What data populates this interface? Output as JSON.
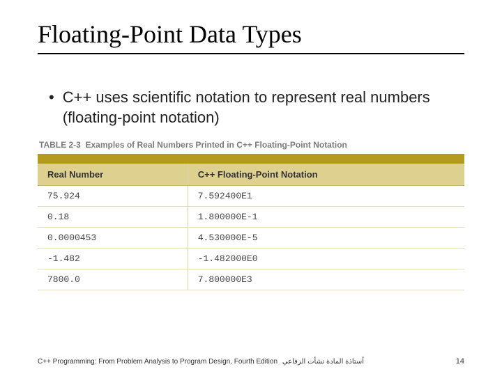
{
  "title": "Floating-Point Data Types",
  "bullets": [
    "C++ uses scientific notation to represent real numbers (floating-point notation)"
  ],
  "table": {
    "caption_prefix": "TABLE 2-3",
    "caption_text": "Examples of Real Numbers Printed in C++ Floating-Point Notation",
    "headers": [
      "Real Number",
      "C++ Floating-Point Notation"
    ],
    "rows": [
      [
        "75.924",
        "7.592400E1"
      ],
      [
        "0.18",
        "1.800000E-1"
      ],
      [
        "0.0000453",
        "4.530000E-5"
      ],
      [
        "-1.482",
        "-1.482000E0"
      ],
      [
        "7800.0",
        "7.800000E3"
      ]
    ]
  },
  "footer": {
    "text_en": "C++ Programming: From Problem Analysis to Program Design, Fourth Edition",
    "text_ar": "أستاذة المادة نشأت الرفاعي",
    "page": "14"
  },
  "icons": {
    "bullet": "•"
  }
}
